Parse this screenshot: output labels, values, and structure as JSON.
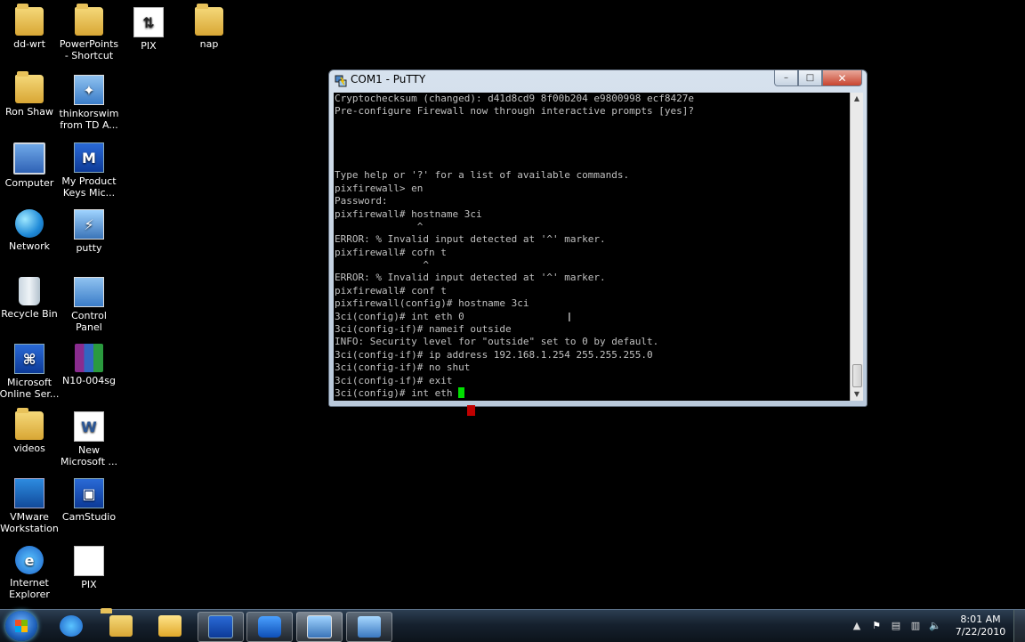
{
  "desktop": {
    "icons": [
      {
        "label": "dd-wrt",
        "icon": "folder-icon"
      },
      {
        "label": "PowerPoints - Shortcut",
        "icon": "folder-shortcut-icon"
      },
      {
        "label": "PIX",
        "icon": "pix-document-icon"
      },
      {
        "label": "nap",
        "icon": "folder-icon"
      },
      {
        "label": "Ron Shaw",
        "icon": "user-folder-icon"
      },
      {
        "label": "thinkorswim from TD A...",
        "icon": "thinkorswim-icon"
      },
      {
        "label": "Computer",
        "icon": "computer-icon"
      },
      {
        "label": "My Product Keys Mic...",
        "icon": "magicjelly-icon"
      },
      {
        "label": "Network",
        "icon": "network-icon"
      },
      {
        "label": "putty",
        "icon": "putty-icon"
      },
      {
        "label": "Recycle Bin",
        "icon": "recycle-bin-icon"
      },
      {
        "label": "Control Panel",
        "icon": "control-panel-icon"
      },
      {
        "label": "Microsoft Online Ser...",
        "icon": "microsoft-online-icon"
      },
      {
        "label": "N10-004sg",
        "icon": "winrar-icon"
      },
      {
        "label": "videos",
        "icon": "folder-icon"
      },
      {
        "label": "New Microsoft ...",
        "icon": "word-document-icon"
      },
      {
        "label": "VMware Workstation",
        "icon": "vmware-icon"
      },
      {
        "label": "CamStudio",
        "icon": "camstudio-icon"
      },
      {
        "label": "Internet Explorer",
        "icon": "internet-explorer-icon"
      },
      {
        "label": "PIX",
        "icon": "document-icon"
      }
    ]
  },
  "putty": {
    "title": "COM1 - PuTTY",
    "buttons": {
      "minimize": "–",
      "maximize": "□",
      "close": "✕"
    },
    "lines": [
      "Cryptochecksum (changed): d41d8cd9 8f00b204 e9800998 ecf8427e",
      "Pre-configure Firewall now through interactive prompts [yes]?",
      "",
      "",
      "",
      "",
      "Type help or '?' for a list of available commands.",
      "pixfirewall> en",
      "Password:",
      "pixfirewall# hostname 3ci",
      "              ^",
      "ERROR: % Invalid input detected at '^' marker.",
      "pixfirewall# cofn t",
      "               ^",
      "ERROR: % Invalid input detected at '^' marker.",
      "pixfirewall# conf t",
      "pixfirewall(config)# hostname 3ci",
      "3ci(config)# int eth 0",
      "3ci(config-if)# nameif outside",
      "INFO: Security level for \"outside\" set to 0 by default.",
      "3ci(config-if)# ip address 192.168.1.254 255.255.255.0",
      "3ci(config-if)# no shut",
      "3ci(config-if)# exit",
      "3ci(config)# int eth "
    ],
    "colors": {
      "background": "#000000",
      "text": "#c0c0c0",
      "cursor": "#00e000"
    }
  },
  "taskbar": {
    "start": "start-orb-icon",
    "pinned": [
      {
        "name": "internet-explorer-icon"
      },
      {
        "name": "windows-explorer-icon"
      },
      {
        "name": "outlook-icon"
      },
      {
        "name": "microsoft-online-icon"
      },
      {
        "name": "teamviewer-icon"
      },
      {
        "name": "putty-icon",
        "active": true
      },
      {
        "name": "camstudio-icon"
      }
    ],
    "tray": {
      "arrow": "▲",
      "time": "8:01 AM",
      "date": "7/22/2010"
    }
  }
}
